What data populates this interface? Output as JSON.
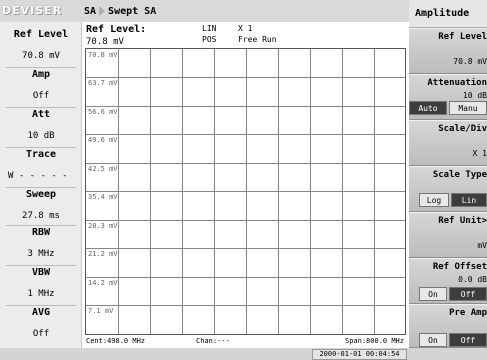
{
  "app": {
    "brand": "DEVISER"
  },
  "mode": {
    "name": "SA",
    "sub": "Swept SA"
  },
  "header": {
    "ref_label": "Ref Level:",
    "ref_value": "70.8 mV",
    "scale_type": "LIN",
    "scale_mult": "X 1",
    "pos": "POS",
    "run": "Free Run"
  },
  "params": [
    {
      "label": "Ref Level",
      "value": "70.8 mV"
    },
    {
      "label": "Amp",
      "value": "Off"
    },
    {
      "label": "Att",
      "value": "10 dB"
    },
    {
      "label": "Trace",
      "value": "W - - - - -"
    },
    {
      "label": "Sweep",
      "value": "27.8 ms"
    },
    {
      "label": "RBW",
      "value": "3 MHz"
    },
    {
      "label": "VBW",
      "value": "1 MHz"
    },
    {
      "label": "AVG",
      "value": "Off"
    }
  ],
  "graticule": {
    "y_labels": [
      "70.8 mV",
      "63.7 mV",
      "56.6 mV",
      "49.6 mV",
      "42.5 mV",
      "35.4 mV",
      "28.3 mV",
      "21.2 mV",
      "14.2 mV",
      "7.1 mV"
    ]
  },
  "footer": {
    "cent": "Cent:498.0 MHz",
    "chan": "Chan:---",
    "span": "Span:800.0 MHz"
  },
  "status": {
    "datetime": "2000-01-01 00:04:54"
  },
  "menu": {
    "title": "Amplitude",
    "ref_level": {
      "label": "Ref Level",
      "value": "70.8 mV"
    },
    "attenuation": {
      "label": "Attenuation",
      "value": "10 dB",
      "opt_a": "Auto",
      "opt_b": "Manu"
    },
    "scale_div": {
      "label": "Scale/Div",
      "value": "X 1"
    },
    "scale_type": {
      "label": "Scale Type",
      "opt_a": "Log",
      "opt_b": "Lin"
    },
    "ref_unit": {
      "label": "Ref Unit>",
      "value": "mV"
    },
    "ref_offset": {
      "label": "Ref Offset",
      "value": "0.0 dB",
      "opt_a": "On",
      "opt_b": "Off"
    },
    "pre_amp": {
      "label": "Pre Amp",
      "opt_a": "On",
      "opt_b": "Off"
    }
  }
}
